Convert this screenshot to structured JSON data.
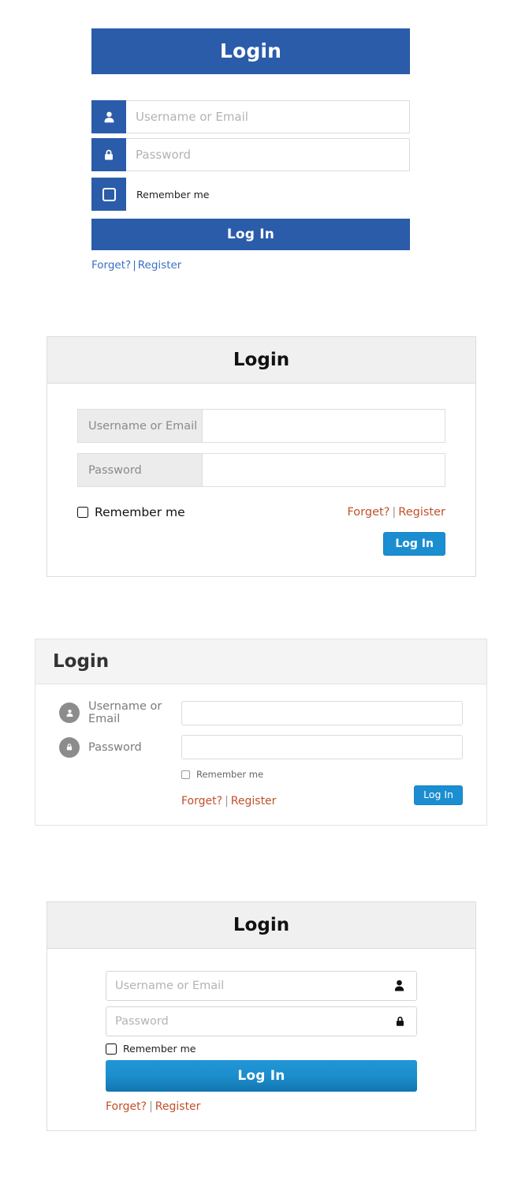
{
  "common": {
    "title": "Login",
    "username_placeholder": "Username or Email",
    "password_placeholder": "Password",
    "remember_label": "Remember me",
    "login_button": "Log In",
    "forget_link": "Forget?",
    "separator": "|",
    "register_link": "Register",
    "user_icon": "user-icon",
    "lock_icon": "lock-icon"
  },
  "colors": {
    "primary_blue": "#2a5caa",
    "bright_blue": "#1b8ed1",
    "gradient_blue_top": "#2196d6",
    "gradient_blue_bottom": "#1276b0",
    "link_blue": "#3c6fc4",
    "link_red": "#c0502a",
    "panel_header_bg": "#f0f0f0",
    "panel_border": "#dddddd",
    "icon_circle_gray": "#8c8c8c"
  },
  "cards": [
    {
      "id": "flat-blue-card",
      "title": "Login",
      "username_placeholder": "Username or Email",
      "password_placeholder": "Password",
      "remember_label": "Remember me",
      "login_button": "Log In",
      "forget_link": "Forget?",
      "separator": "|",
      "register_link": "Register"
    },
    {
      "id": "panel-table-card",
      "title": "Login",
      "username_label": "Username or Email",
      "password_label": "Password",
      "username_value": "",
      "password_value": "",
      "remember_label": "Remember me",
      "login_button": "Log In",
      "forget_link": "Forget?",
      "separator": "|",
      "register_link": "Register"
    },
    {
      "id": "left-header-card",
      "title": "Login",
      "username_label": "Username or Email",
      "password_label": "Password",
      "username_value": "",
      "password_value": "",
      "remember_label": "Remember me",
      "login_button": "Log In",
      "forget_link": "Forget?",
      "separator": "|",
      "register_link": "Register"
    },
    {
      "id": "icon-right-card",
      "title": "Login",
      "username_placeholder": "Username or Email",
      "password_placeholder": "Password",
      "remember_label": "Remember me",
      "login_button": "Log In",
      "forget_link": "Forget?",
      "separator": "|",
      "register_link": "Register"
    }
  ]
}
